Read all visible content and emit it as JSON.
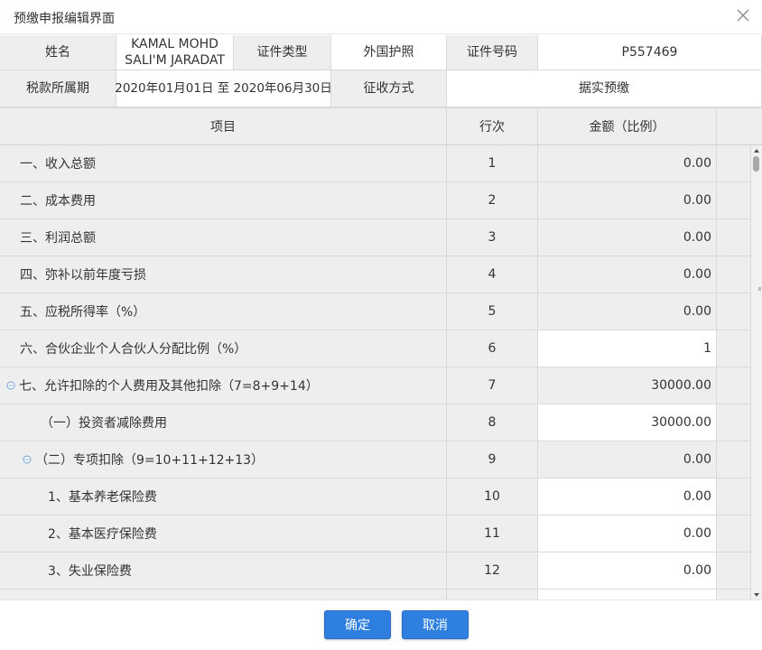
{
  "dialog": {
    "title": "预缴申报编辑界面",
    "close_icon": "close-icon"
  },
  "info": {
    "name_label": "姓名",
    "name_value": "KAMAL MOHD SALI'M JARADAT",
    "id_type_label": "证件类型",
    "id_type_value": "外国护照",
    "id_number_label": "证件号码",
    "id_number_value": "P557469",
    "period_label": "税款所属期",
    "period_value": "2020年01月01日 至 2020年06月30日",
    "method_label": "征收方式",
    "method_value": "据实预缴"
  },
  "table": {
    "headers": {
      "item": "项目",
      "line": "行次",
      "amount": "金额（比例）"
    },
    "rows": [
      {
        "item": "一、收入总额",
        "line": "1",
        "amount": "0.00",
        "editable": false,
        "indent": 0,
        "collapsible": false
      },
      {
        "item": "二、成本费用",
        "line": "2",
        "amount": "0.00",
        "editable": false,
        "indent": 0,
        "collapsible": false
      },
      {
        "item": "三、利润总额",
        "line": "3",
        "amount": "0.00",
        "editable": false,
        "indent": 0,
        "collapsible": false
      },
      {
        "item": "四、弥补以前年度亏损",
        "line": "4",
        "amount": "0.00",
        "editable": false,
        "indent": 0,
        "collapsible": false
      },
      {
        "item": "五、应税所得率（%）",
        "line": "5",
        "amount": "0.00",
        "editable": false,
        "indent": 0,
        "collapsible": false
      },
      {
        "item": "六、合伙企业个人合伙人分配比例（%）",
        "line": "6",
        "amount": "1",
        "editable": true,
        "indent": 0,
        "collapsible": false
      },
      {
        "item": "七、允许扣除的个人费用及其他扣除（7=8+9+14）",
        "line": "7",
        "amount": "30000.00",
        "editable": false,
        "indent": 0,
        "collapsible": true
      },
      {
        "item": "（一）投资者减除费用",
        "line": "8",
        "amount": "30000.00",
        "editable": true,
        "indent": 1,
        "collapsible": false
      },
      {
        "item": "（二）专项扣除（9=10+11+12+13）",
        "line": "9",
        "amount": "0.00",
        "editable": false,
        "indent": 1,
        "collapsible": true
      },
      {
        "item": "1、基本养老保险费",
        "line": "10",
        "amount": "0.00",
        "editable": true,
        "indent": 2,
        "collapsible": false
      },
      {
        "item": "2、基本医疗保险费",
        "line": "11",
        "amount": "0.00",
        "editable": true,
        "indent": 2,
        "collapsible": false
      },
      {
        "item": "3、失业保险费",
        "line": "12",
        "amount": "0.00",
        "editable": true,
        "indent": 2,
        "collapsible": false
      },
      {
        "item": "",
        "line": "",
        "amount": "",
        "editable": true,
        "indent": 2,
        "collapsible": false
      }
    ]
  },
  "footer": {
    "ok_label": "确定",
    "cancel_label": "取消"
  },
  "colors": {
    "button_bg": "#2f7fe0",
    "label_bg": "#eeeeee",
    "border": "#d9d9d9"
  }
}
